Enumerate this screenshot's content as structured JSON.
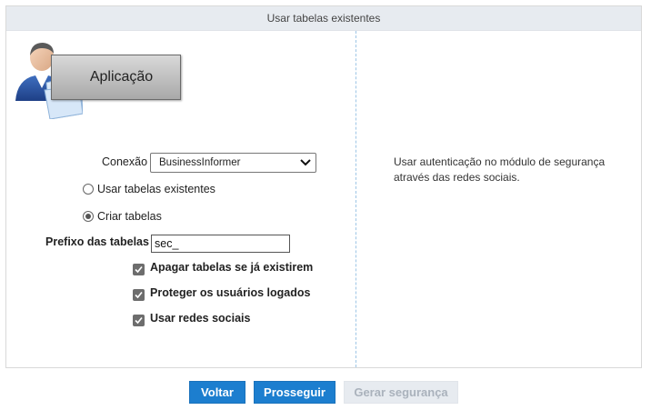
{
  "panel": {
    "title": "Usar tabelas existentes"
  },
  "left": {
    "app_button_label": "Aplicação",
    "conexao_label": "Conexão",
    "conexao_value": "BusinessInformer",
    "radios": [
      {
        "label": "Usar tabelas existentes",
        "checked": false
      },
      {
        "label": "Criar tabelas",
        "checked": true
      }
    ],
    "prefixo_label": "Prefixo das tabelas",
    "prefixo_value": "sec_",
    "checkboxes": [
      {
        "label": "Apagar tabelas se já existirem",
        "checked": true
      },
      {
        "label": "Proteger os usuários logados",
        "checked": true
      },
      {
        "label": "Usar redes sociais",
        "checked": true
      }
    ]
  },
  "right": {
    "info_line1": "Usar autenticação no módulo de segurança",
    "info_line2": "através das redes sociais."
  },
  "buttons": {
    "voltar": "Voltar",
    "prosseguir": "Prosseguir",
    "gerar": "Gerar segurança"
  },
  "colors": {
    "primary": "#1c7ecf",
    "header_bg": "#e7ebf0",
    "divider": "#9ec6e6"
  },
  "icons": {
    "app": "user-folder-icon",
    "select": "chevron-down-icon",
    "check": "checkmark-icon"
  }
}
